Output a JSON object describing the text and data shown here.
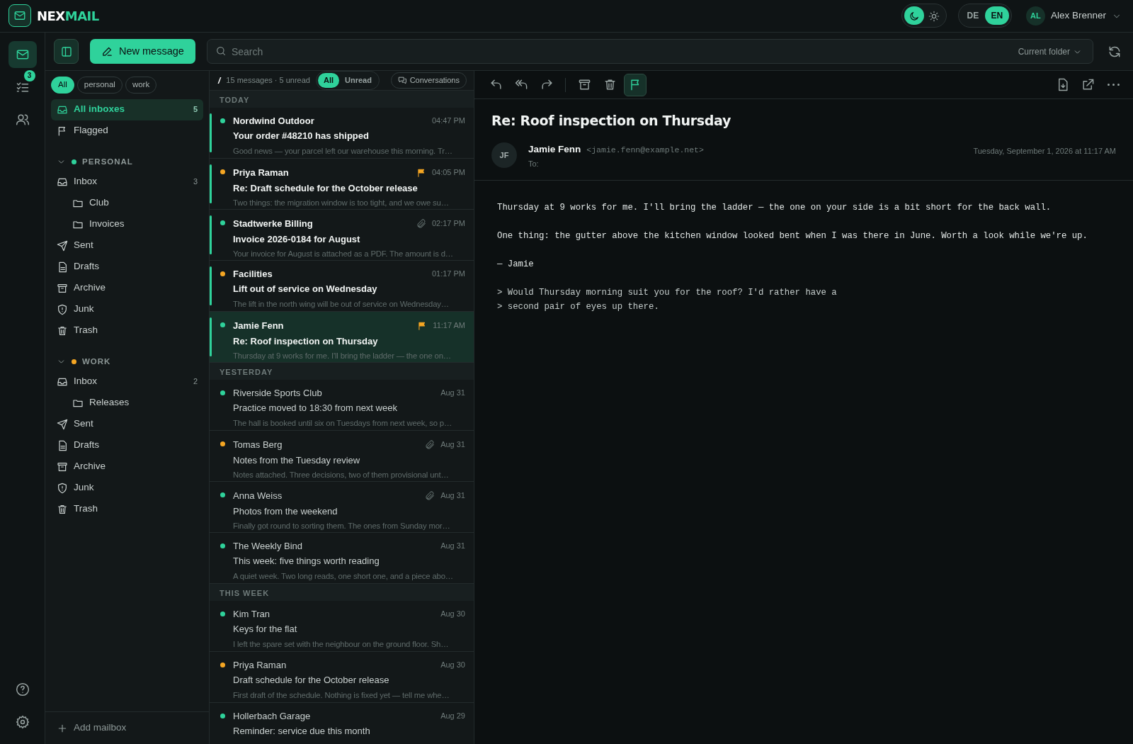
{
  "app": {
    "logo_prefix": "NEX",
    "logo_suffix": "MAIL"
  },
  "theme_toggle": [
    {
      "kind": "dark",
      "selected": true
    },
    {
      "kind": "light",
      "selected": false
    }
  ],
  "languages": [
    {
      "label": "DE",
      "selected": false
    },
    {
      "label": "EN",
      "selected": true
    }
  ],
  "user": {
    "initials": "AL",
    "name": "Alex Brenner"
  },
  "rail": [
    {
      "kind": "mail",
      "selected": true
    },
    {
      "kind": "tasks",
      "selected": false,
      "badge": "3"
    },
    {
      "kind": "contacts",
      "selected": false
    }
  ],
  "rail_bottom": [
    {
      "kind": "help"
    },
    {
      "kind": "settings"
    }
  ],
  "toolbar": {
    "new_message": "New message",
    "search": {
      "placeholder": "Search"
    },
    "scope": "Current folder"
  },
  "tag_filters": [
    {
      "label": "All",
      "selected": true
    },
    {
      "label": "personal",
      "selected": false
    },
    {
      "label": "work",
      "selected": false
    }
  ],
  "sidebar": {
    "items": [
      {
        "kind": "inbox",
        "label": "All inboxes",
        "count": "5",
        "selected": true
      },
      {
        "kind": "flag",
        "label": "Flagged",
        "selected": false
      }
    ],
    "accounts": [
      {
        "name": "PERSONAL",
        "color": "#2fd29b",
        "expanded": true,
        "folders": [
          {
            "kind": "inbox",
            "label": "Inbox",
            "count": "3",
            "children": [
              {
                "kind": "folder",
                "label": "Club"
              },
              {
                "kind": "folder",
                "label": "Invoices"
              }
            ]
          },
          {
            "kind": "sent",
            "label": "Sent"
          },
          {
            "kind": "drafts",
            "label": "Drafts"
          },
          {
            "kind": "archive",
            "label": "Archive"
          },
          {
            "kind": "junk",
            "label": "Junk"
          },
          {
            "kind": "trash",
            "label": "Trash"
          }
        ]
      },
      {
        "name": "WORK",
        "color": "#f5a623",
        "expanded": true,
        "folders": [
          {
            "kind": "inbox",
            "label": "Inbox",
            "count": "2",
            "children": [
              {
                "kind": "folder",
                "label": "Releases"
              }
            ]
          },
          {
            "kind": "sent",
            "label": "Sent"
          },
          {
            "kind": "drafts",
            "label": "Drafts"
          },
          {
            "kind": "archive",
            "label": "Archive"
          },
          {
            "kind": "junk",
            "label": "Junk"
          },
          {
            "kind": "trash",
            "label": "Trash"
          }
        ]
      }
    ],
    "add_mailbox": "Add mailbox"
  },
  "message_list": {
    "heading_fragment": "/",
    "summary": "15 messages · 5 unread",
    "filters": [
      {
        "label": "All",
        "selected": true
      },
      {
        "label": "Unread",
        "selected": false
      }
    ],
    "conversations": "Conversations",
    "groups": [
      {
        "label": "TODAY",
        "messages": [
          {
            "sender": "Nordwind Outdoor",
            "time": "04:47 PM",
            "subject": "Your order #48210 has shipped",
            "preview": "Good news — your parcel left our warehouse this morning. Tr…",
            "color": "#2fd29b",
            "unread": true,
            "flagged": false,
            "attachment": false,
            "selected": false
          },
          {
            "sender": "Priya Raman",
            "time": "04:05 PM",
            "subject": "Re: Draft schedule for the October release",
            "preview": "Two things: the migration window is too tight, and we owe su…",
            "color": "#f5a623",
            "unread": true,
            "flagged": true,
            "attachment": false,
            "selected": false
          },
          {
            "sender": "Stadtwerke Billing",
            "time": "02:17 PM",
            "subject": "Invoice 2026-0184 for August",
            "preview": "Your invoice for August is attached as a PDF. The amount is d…",
            "color": "#2fd29b",
            "unread": true,
            "flagged": false,
            "attachment": true,
            "selected": false
          },
          {
            "sender": "Facilities",
            "time": "01:17 PM",
            "subject": "Lift out of service on Wednesday",
            "preview": "The lift in the north wing will be out of service on Wednesday…",
            "color": "#f5a623",
            "unread": true,
            "flagged": false,
            "attachment": false,
            "selected": false
          },
          {
            "sender": "Jamie Fenn",
            "time": "11:17 AM",
            "subject": "Re: Roof inspection on Thursday",
            "preview": "Thursday at 9 works for me. I'll bring the ladder — the one on…",
            "color": "#2fd29b",
            "unread": true,
            "flagged": true,
            "attachment": false,
            "selected": true
          }
        ]
      },
      {
        "label": "YESTERDAY",
        "messages": [
          {
            "sender": "Riverside Sports Club",
            "time": "Aug 31",
            "subject": "Practice moved to 18:30 from next week",
            "preview": "The hall is booked until six on Tuesdays from next week, so p…",
            "color": "#2fd29b",
            "unread": false,
            "flagged": false,
            "attachment": false,
            "selected": false
          },
          {
            "sender": "Tomas Berg",
            "time": "Aug 31",
            "subject": "Notes from the Tuesday review",
            "preview": "Notes attached. Three decisions, two of them provisional unt…",
            "color": "#f5a623",
            "unread": false,
            "flagged": false,
            "attachment": true,
            "selected": false
          },
          {
            "sender": "Anna Weiss",
            "time": "Aug 31",
            "subject": "Photos from the weekend",
            "preview": "Finally got round to sorting them. The ones from Sunday mor…",
            "color": "#2fd29b",
            "unread": false,
            "flagged": false,
            "attachment": true,
            "selected": false
          },
          {
            "sender": "The Weekly Bind",
            "time": "Aug 31",
            "subject": "This week: five things worth reading",
            "preview": "A quiet week. Two long reads, one short one, and a piece abo…",
            "color": "#2fd29b",
            "unread": false,
            "flagged": false,
            "attachment": false,
            "selected": false
          }
        ]
      },
      {
        "label": "THIS WEEK",
        "messages": [
          {
            "sender": "Kim Tran",
            "time": "Aug 30",
            "subject": "Keys for the flat",
            "preview": "I left the spare set with the neighbour on the ground floor. Sh…",
            "color": "#2fd29b",
            "unread": false,
            "flagged": false,
            "attachment": false,
            "selected": false
          },
          {
            "sender": "Priya Raman",
            "time": "Aug 30",
            "subject": "Draft schedule for the October release",
            "preview": "First draft of the schedule. Nothing is fixed yet — tell me whe…",
            "color": "#f5a623",
            "unread": false,
            "flagged": false,
            "attachment": false,
            "selected": false
          },
          {
            "sender": "Hollerbach Garage",
            "time": "Aug 29",
            "subject": "Reminder: service due this month",
            "color": "#2fd29b",
            "unread": false,
            "flagged": false,
            "attachment": false,
            "selected": false
          }
        ]
      }
    ]
  },
  "reader": {
    "tools": [
      {
        "kind": "reply",
        "on": false
      },
      {
        "kind": "reply-all",
        "on": false
      },
      {
        "kind": "forward",
        "on": false
      },
      {
        "kind": "divider"
      },
      {
        "kind": "archive",
        "on": false
      },
      {
        "kind": "delete",
        "on": false
      },
      {
        "kind": "flag",
        "on": true
      }
    ],
    "tools_right": [
      {
        "kind": "download"
      },
      {
        "kind": "external"
      },
      {
        "kind": "more"
      }
    ],
    "subject": "Re: Roof inspection on Thursday",
    "from": {
      "initials": "JF",
      "name": "Jamie Fenn",
      "email": "<jamie.fenn@example.net>"
    },
    "to_label": "To:",
    "date": "Tuesday, September 1, 2026 at 11:17 AM",
    "body": [
      {
        "kind": "text",
        "lines": [
          "Thursday at 9 works for me. I'll bring the ladder — the one on your side is a bit short for the back wall."
        ]
      },
      {
        "kind": "text",
        "lines": [
          "One thing: the gutter above the kitchen window looked bent when I was there in June. Worth a look while we're up."
        ]
      },
      {
        "kind": "text",
        "lines": [
          "— Jamie"
        ]
      },
      {
        "kind": "quote",
        "lines": [
          "> Would Thursday morning suit you for the roof? I'd rather have a",
          "> second pair of eyes up there."
        ]
      }
    ]
  }
}
